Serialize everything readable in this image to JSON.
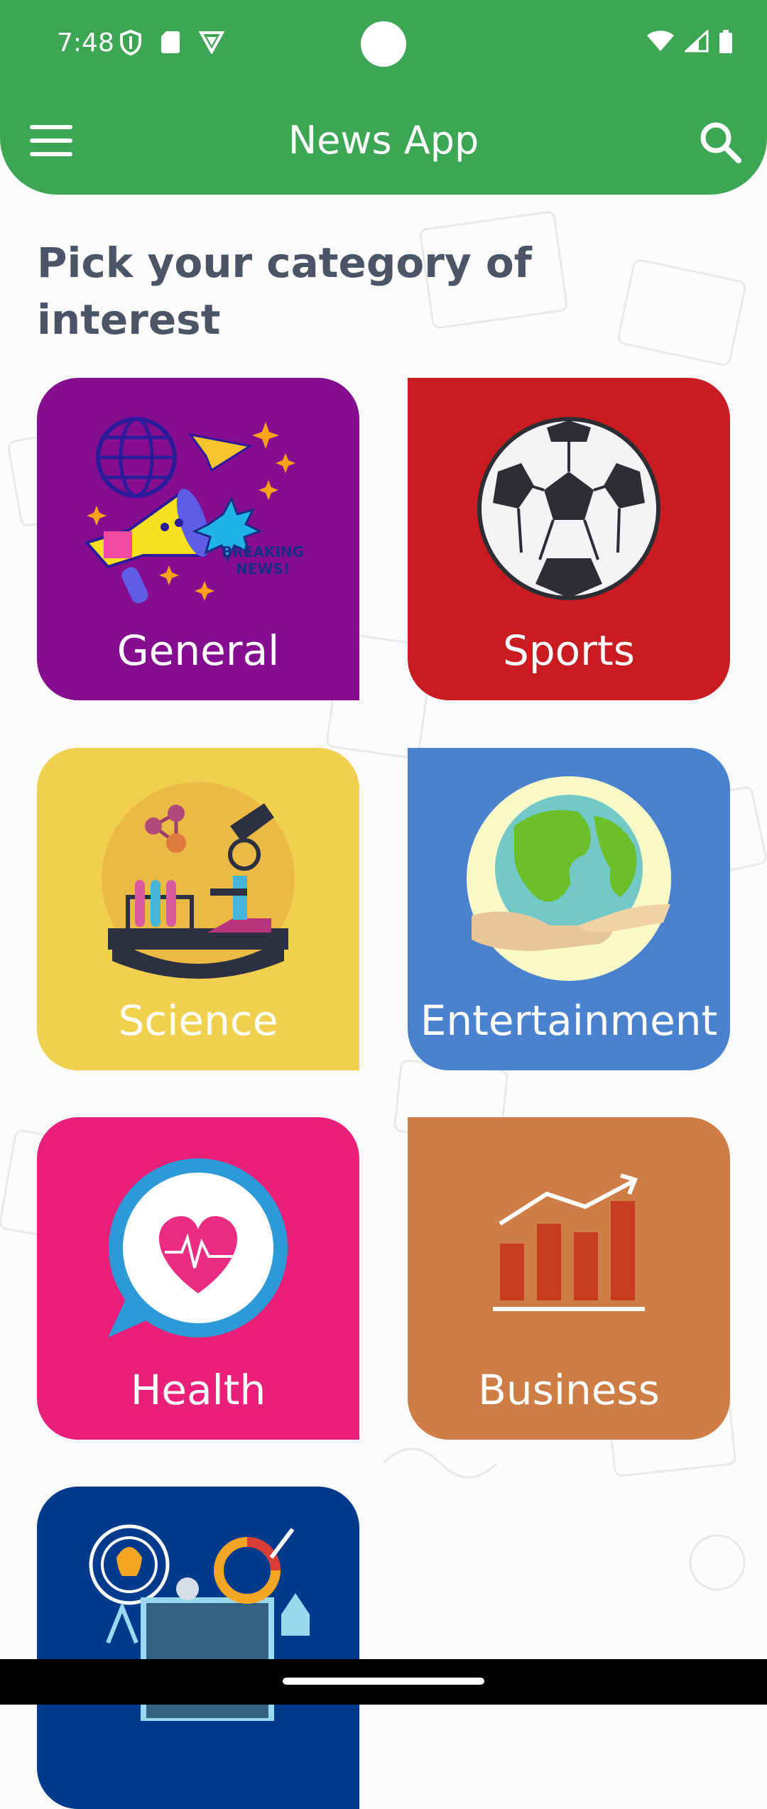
{
  "status_bar": {
    "time": "7:48",
    "left_icons": [
      "shield-icon",
      "sd-card-icon",
      "vpn-icon"
    ],
    "right_icons": [
      "wifi-icon",
      "signal-icon",
      "battery-icon"
    ]
  },
  "app_bar": {
    "title": "News App",
    "menu_icon": "menu-icon",
    "search_icon": "search-icon",
    "color": "#3da654"
  },
  "heading": "Pick your category of interest",
  "categories": [
    {
      "label": "General",
      "color": "#840e8f",
      "icon": "megaphone-icon"
    },
    {
      "label": "Sports",
      "color": "#c81c22",
      "icon": "soccer-ball-icon"
    },
    {
      "label": "Science",
      "color": "#f1d04f",
      "icon": "microscope-icon"
    },
    {
      "label": "Entertainment",
      "color": "#4b82d0",
      "icon": "earth-hands-icon"
    },
    {
      "label": "Health",
      "color": "#ea1f7a",
      "icon": "heart-chat-icon"
    },
    {
      "label": "Business",
      "color": "#cf7d47",
      "icon": "bar-chart-icon"
    },
    {
      "label": "",
      "color": "#003a8c",
      "icon": "technology-icon"
    }
  ]
}
